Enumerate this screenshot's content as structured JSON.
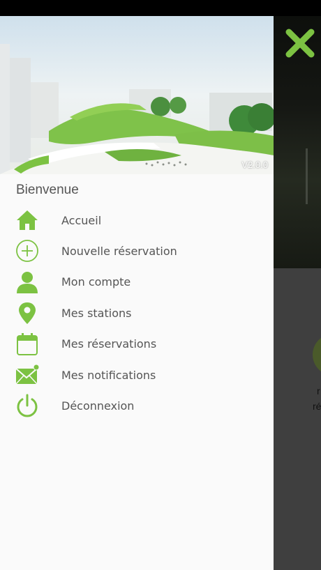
{
  "colors": {
    "accent": "#7cc242",
    "text": "#555555",
    "drawer_bg": "#fafafa"
  },
  "header": {
    "version": "V2.0.0",
    "image": "green-roof-architecture-photo"
  },
  "welcome": "Bienvenue",
  "menu": [
    {
      "label": "Accueil",
      "icon": "home-icon"
    },
    {
      "label": "Nouvelle réservation",
      "icon": "plus-circle-icon"
    },
    {
      "label": "Mon compte",
      "icon": "user-icon"
    },
    {
      "label": "Mes stations",
      "icon": "map-pin-icon"
    },
    {
      "label": "Mes réservations",
      "icon": "calendar-icon"
    },
    {
      "label": "Mes notifications",
      "icon": "envelope-icon"
    },
    {
      "label": "Déconnexion",
      "icon": "power-icon"
    }
  ],
  "background": {
    "partial_text_1": "r",
    "partial_text_2": "ré"
  }
}
